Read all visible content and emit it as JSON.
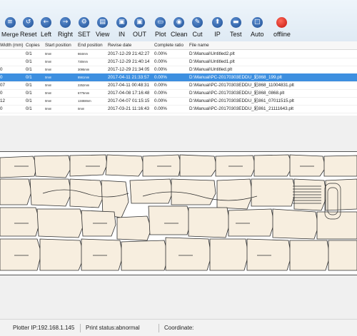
{
  "toolbar": {
    "merge": "Merge",
    "reset": "Reset",
    "left": "Left",
    "right": "Right",
    "set": "SET",
    "view": "View",
    "in": "IN",
    "out": "OUT",
    "plot": "Plot",
    "clean": "Clean",
    "cut": "Cut",
    "ip": "IP",
    "test": "Test",
    "auto": "Auto",
    "offline": "offline"
  },
  "table": {
    "headers": [
      "Width (mm)",
      "Copies",
      "Start position",
      "End position",
      "Revise date",
      "Complete ratio",
      "File name"
    ],
    "rows": [
      {
        "width": "",
        "copies": "0/1",
        "start": "0mm",
        "end": "664mm",
        "date": "2017-12-29 21:42:27",
        "ratio": "0.00%",
        "file": "D:\\Manual\\Untitled2.plt"
      },
      {
        "width": "",
        "copies": "0/1",
        "start": "0mm",
        "end": "730mm",
        "date": "2017-12-29 21:40:14",
        "ratio": "0.00%",
        "file": "D:\\Manual\\Untitled1.plt"
      },
      {
        "width": "0",
        "copies": "0/1",
        "start": "0mm",
        "end": "3095mm",
        "date": "2017-12-29 21:34:05",
        "ratio": "0.00%",
        "file": "D:\\Manual\\Untitled.plt"
      },
      {
        "width": "0",
        "copies": "0/1",
        "start": "0mm",
        "end": "8561mm",
        "date": "2017-04-11 21:33:57",
        "ratio": "0.00%",
        "file": "D:\\Manual\\PC-20170303EDDU_彩868_199.plt"
      },
      {
        "width": "07",
        "copies": "0/1",
        "start": "0mm",
        "end": "2252mm",
        "date": "2017-04-11 00:48:31",
        "ratio": "0.00%",
        "file": "D:\\Manual\\PC-20170303EDDU_彩868_11004831.plt"
      },
      {
        "width": "0",
        "copies": "0/1",
        "start": "0mm",
        "end": "6775mm",
        "date": "2017-04-08 17:16:48",
        "ratio": "0.00%",
        "file": "D:\\Manual\\PC-20170303EDDU_彩868_0868.plt"
      },
      {
        "width": "12",
        "copies": "0/1",
        "start": "0mm",
        "end": "13468mm",
        "date": "2017-04-07 01:15:15",
        "ratio": "0.00%",
        "file": "D:\\Manual\\PC-20170303EDDU_彩861_07011515.plt"
      },
      {
        "width": "0",
        "copies": "0/1",
        "start": "0mm",
        "end": "0mm",
        "date": "2017-03-21 11:16:43",
        "ratio": "0.00%",
        "file": "D:\\Manual\\PC-20170303EDDU_彩861_21111643.plt"
      }
    ]
  },
  "status": {
    "plotter_ip": "Plotter IP:192.168.1.145",
    "print_status": "Print status:abnormal",
    "coordinate": "Coordinate:"
  }
}
